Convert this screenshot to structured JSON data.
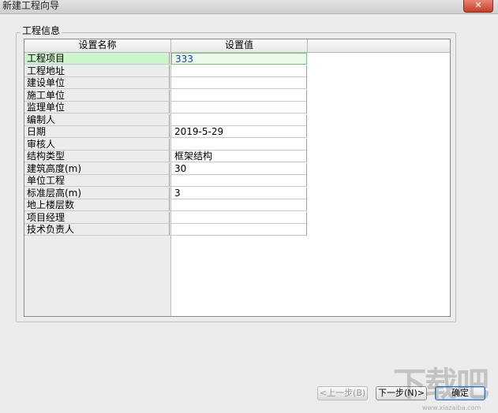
{
  "window": {
    "title": "新建工程向导",
    "close_glyph": "✕"
  },
  "group": {
    "title": "工程信息"
  },
  "grid": {
    "headers": [
      "设置名称",
      "设置值"
    ],
    "rows": [
      {
        "name": "工程项目",
        "value": "333"
      },
      {
        "name": "工程地址",
        "value": ""
      },
      {
        "name": "建设单位",
        "value": ""
      },
      {
        "name": "施工单位",
        "value": ""
      },
      {
        "name": "监理单位",
        "value": ""
      },
      {
        "name": "编制人",
        "value": ""
      },
      {
        "name": "日期",
        "value": "2019-5-29"
      },
      {
        "name": "审核人",
        "value": ""
      },
      {
        "name": "结构类型",
        "value": "框架结构"
      },
      {
        "name": "建筑高度(m)",
        "value": "30"
      },
      {
        "name": "单位工程",
        "value": ""
      },
      {
        "name": "标准层高(m)",
        "value": "3"
      },
      {
        "name": "地上楼层数",
        "value": ""
      },
      {
        "name": "项目经理",
        "value": ""
      },
      {
        "name": "技术负责人",
        "value": ""
      }
    ],
    "selected_row": 0
  },
  "buttons": {
    "prev": "<上一步(B)",
    "next": "下一步(N)>",
    "ok": "确定"
  },
  "watermark": {
    "text": "下载吧",
    "sub": "www.xiazaiba.com"
  }
}
